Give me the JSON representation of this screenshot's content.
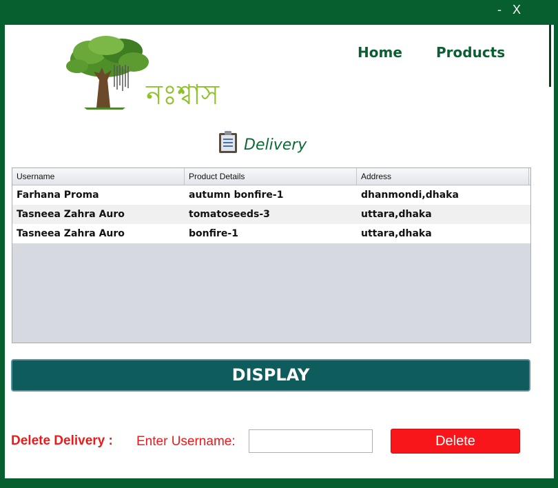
{
  "window": {
    "minimize": "-",
    "close": "X"
  },
  "logo": {
    "text": "নঃশ্বাস",
    "icon": "tree-logo"
  },
  "nav": {
    "home": "Home",
    "products": "Products"
  },
  "section": {
    "title": "Delivery",
    "icon": "clipboard-icon"
  },
  "table": {
    "columns": [
      "Username",
      "Product Details",
      "Address"
    ],
    "rows": [
      [
        "Farhana Proma",
        "autumn bonfire-1",
        "dhanmondi,dhaka"
      ],
      [
        "Tasneea Zahra Auro",
        "tomatoseeds-3",
        "uttara,dhaka"
      ],
      [
        "Tasneea Zahra Auro",
        "bonfire-1",
        "uttara,dhaka"
      ]
    ]
  },
  "display_button": "DISPLAY",
  "delete_section": {
    "label": "Delete Delivery :",
    "username_label": "Enter Username:",
    "username_value": "",
    "button": "Delete"
  },
  "colors": {
    "frame": "#075f2f",
    "nav_text": "#0c5e32",
    "display_button": "#0e5c5c",
    "delete_red": "#f8161a",
    "label_red": "#f01818"
  }
}
